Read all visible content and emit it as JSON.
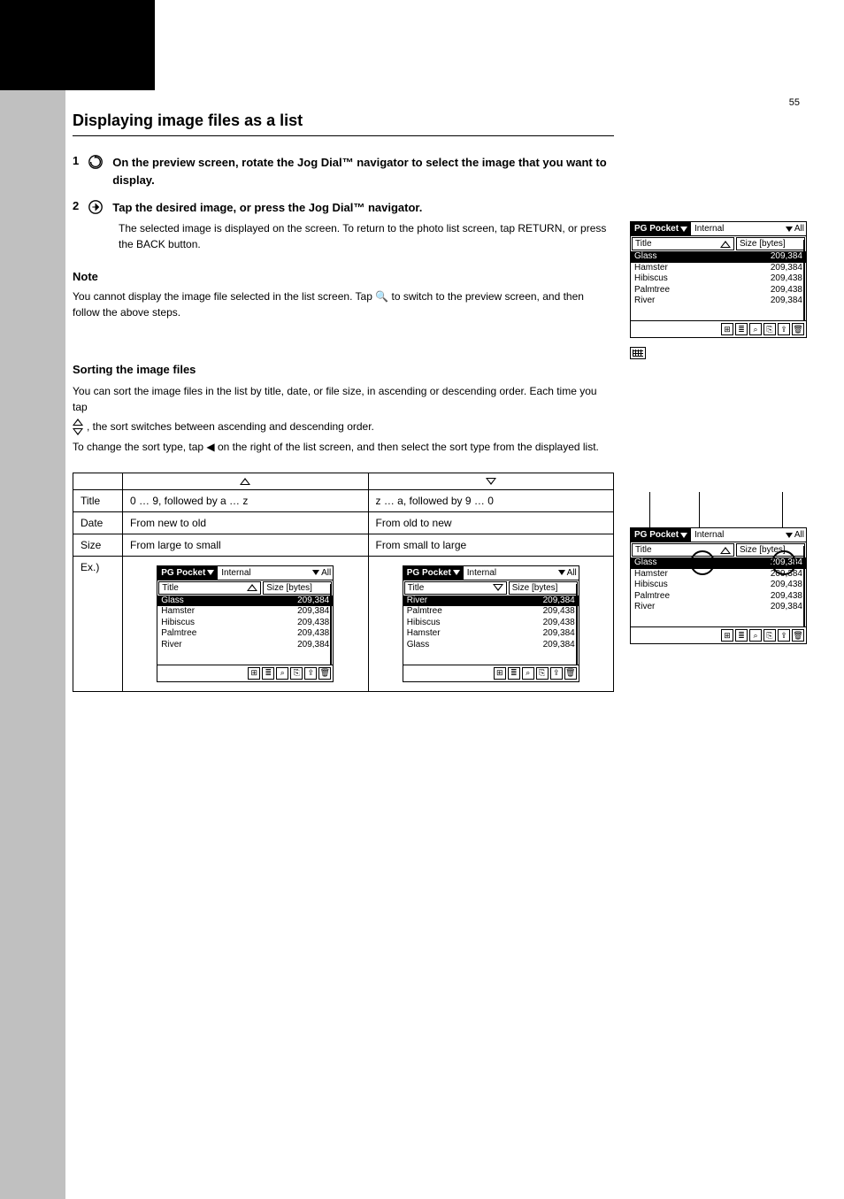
{
  "page_number": "55",
  "section_title": "Displaying image files as a list",
  "steps": [
    {
      "num": "1",
      "text": "On the preview screen, rotate the Jog Dial™ navigator to select the image that you want to display."
    },
    {
      "num": "2",
      "text": "Tap the desired image, or press the Jog Dial™ navigator.",
      "sub": "The selected image is displayed on the screen.\nTo return to the photo list screen, tap RETURN, or press the BACK button."
    }
  ],
  "note": {
    "head": "Note",
    "body": "You cannot display the image file selected in the list screen. Tap 🔍 to switch to the preview screen, and then follow the above steps."
  },
  "sorting": {
    "head": "Sorting the image files",
    "body_1": "You can sort the image files in the list by title, date, or file size, in ascending or descending order. Each time you tap",
    "body_2": ", the sort switches between ascending and descending order.",
    "body_3": "To change the sort type, tap ◀ on the right of the list screen, and then select the sort type from the displayed list."
  },
  "compare": {
    "rows": [
      {
        "label": "Title",
        "asc": "0 … 9, followed by a … z",
        "desc": "z … a, followed by 9 … 0"
      },
      {
        "label": "Date",
        "asc": "From new to old",
        "desc": "From old to new"
      },
      {
        "label": "Size",
        "asc": "From large to small",
        "desc": "From small to large"
      },
      {
        "label": "Ex.)",
        "asc": "",
        "desc": ""
      }
    ]
  },
  "pg_common": {
    "app": "PG Pocket",
    "storage": "Internal",
    "filter": "All",
    "col_title": "Title",
    "col_size": "Size [bytes]"
  },
  "pg_asc": {
    "sort_dir": "up",
    "rows": [
      {
        "title": "Glass",
        "size": "209,384",
        "sel": true
      },
      {
        "title": "Hamster",
        "size": "209,384"
      },
      {
        "title": "Hibiscus",
        "size": "209,438"
      },
      {
        "title": "Palmtree",
        "size": "209,438"
      },
      {
        "title": "River",
        "size": "209,384"
      }
    ]
  },
  "pg_desc": {
    "sort_dir": "down",
    "rows": [
      {
        "title": "River",
        "size": "209,384",
        "sel": true
      },
      {
        "title": "Palmtree",
        "size": "209,438"
      },
      {
        "title": "Hibiscus",
        "size": "209,438"
      },
      {
        "title": "Hamster",
        "size": "209,384"
      },
      {
        "title": "Glass",
        "size": "209,384"
      }
    ]
  },
  "pg_top": {
    "sort_dir": "up",
    "rows": [
      {
        "title": "Glass",
        "size": "209,384",
        "sel": true
      },
      {
        "title": "Hamster",
        "size": "209,384"
      },
      {
        "title": "Hibiscus",
        "size": "209,438"
      },
      {
        "title": "Palmtree",
        "size": "209,438"
      },
      {
        "title": "River",
        "size": "209,384"
      }
    ]
  },
  "pg_hi": {
    "sort_dir": "up",
    "rows": [
      {
        "title": "Glass",
        "size": "209,384",
        "sel": true
      },
      {
        "title": "Hamster",
        "size": "209,384"
      },
      {
        "title": "Hibiscus",
        "size": "209,438"
      },
      {
        "title": "Palmtree",
        "size": "209,438"
      },
      {
        "title": "River",
        "size": "209,384"
      }
    ]
  },
  "toolbar_icons": [
    "grid-view-icon",
    "list-view-icon",
    "zoom-icon",
    "save-icon",
    "share-icon",
    "trash-icon"
  ]
}
